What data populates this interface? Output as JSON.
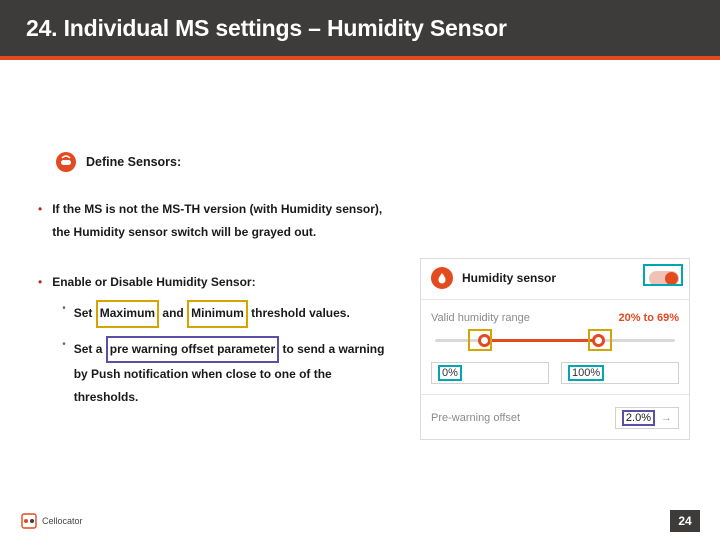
{
  "title": "24. Individual MS settings – Humidity Sensor",
  "define_label": "Define Sensors:",
  "bullets": {
    "b1": "If the MS is not the MS-TH version (with Humidity sensor), the Humidity sensor switch will be grayed out.",
    "b2": "Enable or Disable Humidity Sensor:",
    "sub1_prefix": "Set ",
    "sub1_max": "Maximum",
    "sub1_mid": " and ",
    "sub1_min": "Minimum",
    "sub1_suffix": " threshold values.",
    "sub2_prefix": "Set a ",
    "sub2_box": "pre warning offset parameter",
    "sub2_suffix": " to send a warning by Push notification when close to one of the thresholds."
  },
  "card": {
    "title": "Humidity sensor",
    "range_label": "Valid humidity range",
    "range_val": "20% to 69%",
    "min": "0%",
    "max": "100%",
    "offset_label": "Pre-warning offset",
    "offset_val": "2.0%"
  },
  "footer": {
    "brand": "Cellocator",
    "page": "24"
  }
}
